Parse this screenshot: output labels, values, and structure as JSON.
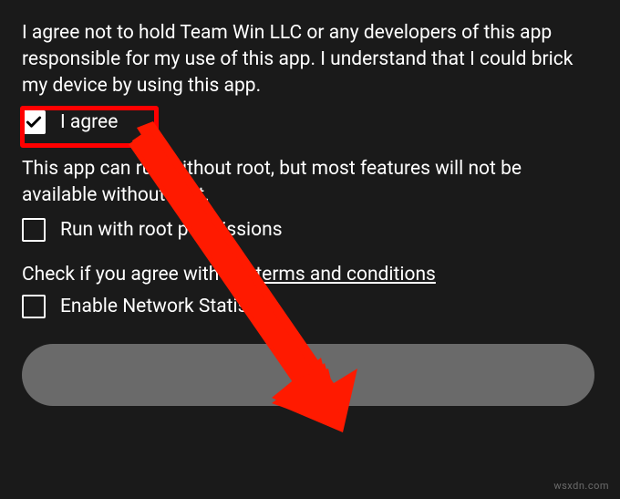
{
  "disclaimer": "I agree not to hold Team Win LLC or any developers of this app responsible for my use of this app. I understand that I could brick my device by using this app.",
  "agree_checkbox": {
    "label": "I agree",
    "checked": true
  },
  "root_info": "This app can run without root, but most features will not be available without root.",
  "root_checkbox": {
    "label": "Run with root permissions",
    "checked": false
  },
  "terms_prefix": "Check if you agree with the ",
  "terms_link_text": "terms and conditions",
  "stats_checkbox": {
    "label": "Enable Network Statistics",
    "checked": false
  },
  "ok_button_label": "OK",
  "watermark": "wsxdn.com",
  "annotation": {
    "highlight_color": "#ff0000",
    "arrow_color": "#ff1a00"
  }
}
